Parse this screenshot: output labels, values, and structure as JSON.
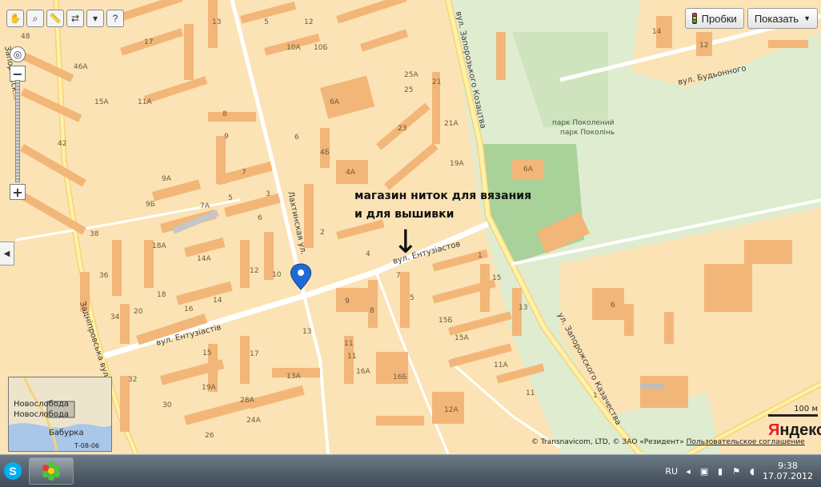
{
  "map": {
    "building_numbers": [
      "48",
      "17",
      "13",
      "5",
      "12",
      "10А",
      "10Б",
      "46А",
      "15А",
      "11А",
      "25А",
      "25",
      "21",
      "6А",
      "21А",
      "19А",
      "8",
      "23",
      "6",
      "4Б",
      "4А",
      "9",
      "42",
      "7",
      "5",
      "9А",
      "9Б",
      "7А",
      "6",
      "3",
      "38",
      "2",
      "18А",
      "14А",
      "12",
      "10",
      "36",
      "16",
      "14",
      "18",
      "20",
      "34",
      "4",
      "9",
      "8",
      "7",
      "5",
      "15Б",
      "15А",
      "13",
      "15",
      "11",
      "11А",
      "17",
      "13А",
      "16А",
      "16Б",
      "15",
      "19А",
      "28А",
      "30",
      "24А",
      "32",
      "26",
      "12А",
      "11",
      "13",
      "1",
      "1",
      "6",
      "6А",
      "12",
      "14",
      "11"
    ],
    "streets": [
      {
        "name": "вул. Ентузіастів",
        "id": "entuziastiv"
      },
      {
        "name": "вул. Ентузіастов",
        "id": "entuziastov"
      },
      {
        "name": "Лахтинская ул.",
        "id": "lakhtinskaya"
      },
      {
        "name": "вул. Запорозького Козацтва",
        "id": "zaporozkogo"
      },
      {
        "name": "ул. Запорожского Казачества",
        "id": "zaporozhskogo"
      },
      {
        "name": "вул. Будьонного",
        "id": "budyonnogo"
      },
      {
        "name": "Задніпровська вул.",
        "id": "zadniprovska"
      },
      {
        "name": "Запорожск...",
        "id": "zap-left"
      }
    ],
    "park_labels": [
      "парк Поколений",
      "парк Поколінь"
    ],
    "annotation_line1": "магазин  ниток для вязания",
    "annotation_line2": "и для вышивки",
    "annotation_arrow": "↓"
  },
  "toolbar": {
    "icons": [
      "hand-icon",
      "zoom-box-icon",
      "ruler-icon",
      "route-icon",
      "print-icon",
      "help-cursor-icon"
    ]
  },
  "top_right": {
    "traffic_label": "Пробки",
    "show_label": "Показать",
    "show_caret": "▼"
  },
  "scale": {
    "label": "100 м"
  },
  "logo": {
    "brand_first": "Я",
    "brand_rest": "ндекс"
  },
  "copyright": {
    "text": "© Transnavicom, LTD, © ЗАО «Резидент»",
    "link": "Пользовательское соглашение"
  },
  "minimap": {
    "labels": [
      "Новослобода",
      "Новослобода",
      "Бабурка",
      "Т-08-06"
    ]
  },
  "taskbar": {
    "lang": "RU",
    "time": "9:38",
    "date": "17.07.2012"
  },
  "colors": {
    "map_bg": "#fbe3b5",
    "building": "#f2b679",
    "road": "#ffffff",
    "major_road": "#ffe79a",
    "park": "#cfe3bf",
    "park_inner": "#a9d19a",
    "pin": "#1e6ad8"
  }
}
